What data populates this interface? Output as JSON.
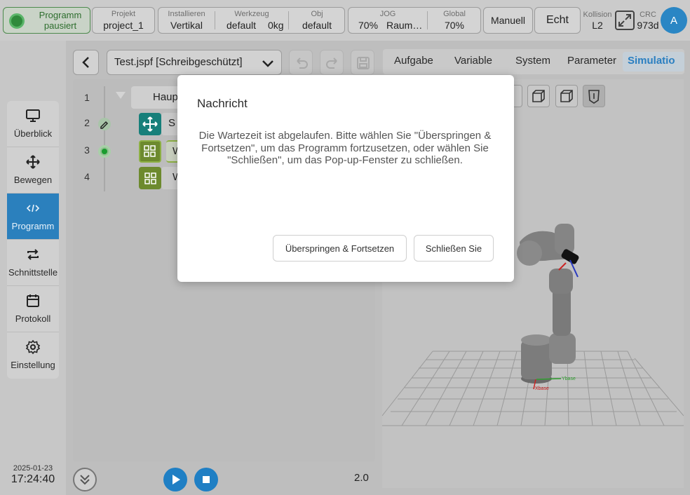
{
  "topbar": {
    "status": {
      "line1": "Programm",
      "line2": "pausiert"
    },
    "project": {
      "label": "Projekt",
      "value": "project_1"
    },
    "install": {
      "label": "Installieren",
      "value": "Vertikal"
    },
    "tool": {
      "label": "Werkzeug",
      "value": "default",
      "weight": "0kg"
    },
    "obj": {
      "label": "Obj",
      "value": "default"
    },
    "jog": {
      "label": "JOG",
      "value": "70%",
      "mode": "Raum…"
    },
    "global": {
      "label": "Global",
      "value": "70%"
    },
    "mode_button": "Manuell",
    "real_button": "Echt",
    "collision": {
      "label": "Kollision",
      "value": "L2"
    },
    "crc": {
      "label": "CRC",
      "value": "973d"
    },
    "avatar": "A"
  },
  "sidebar": {
    "items": [
      {
        "label": "Überblick",
        "icon": "monitor-icon"
      },
      {
        "label": "Bewegen",
        "icon": "move-icon"
      },
      {
        "label": "Programm",
        "icon": "code-icon",
        "active": true
      },
      {
        "label": "Schnittstelle",
        "icon": "interface-icon"
      },
      {
        "label": "Protokoll",
        "icon": "calendar-icon"
      },
      {
        "label": "Einstellung",
        "icon": "gear-icon"
      }
    ],
    "date": "2025-01-23",
    "time": "17:24:40"
  },
  "toolbar": {
    "file_name": "Test.jspf [Schreibgeschützt]"
  },
  "tabs": [
    "Aufgabe",
    "Variable",
    "System",
    "Parameter",
    "Simulatio"
  ],
  "editor": {
    "line_numbers": [
      "1",
      "2",
      "3",
      "4"
    ],
    "rows": [
      {
        "text": "Haup"
      },
      {
        "text": "S"
      },
      {
        "text": "W"
      },
      {
        "text": "W"
      }
    ]
  },
  "bottom": {
    "speed": "2.0"
  },
  "dialog": {
    "title": "Nachricht",
    "message": "Die Wartezeit ist abgelaufen. Bitte wählen Sie \"Überspringen & Fortsetzen\", um das Programm fortzusetzen, oder wählen Sie \"Schließen\", um das Pop-up-Fenster zu schließen.",
    "skip_button": "Überspringen & Fortsetzen",
    "close_button": "Schließen Sie"
  },
  "viewer": {
    "axis_x": "Xbase",
    "axis_y": "Ybase"
  },
  "colors": {
    "accent": "#2b80bd",
    "status_green": "#2f8a3c",
    "row_teal": "#177f7a",
    "row_olive": "#6d8a2e"
  }
}
